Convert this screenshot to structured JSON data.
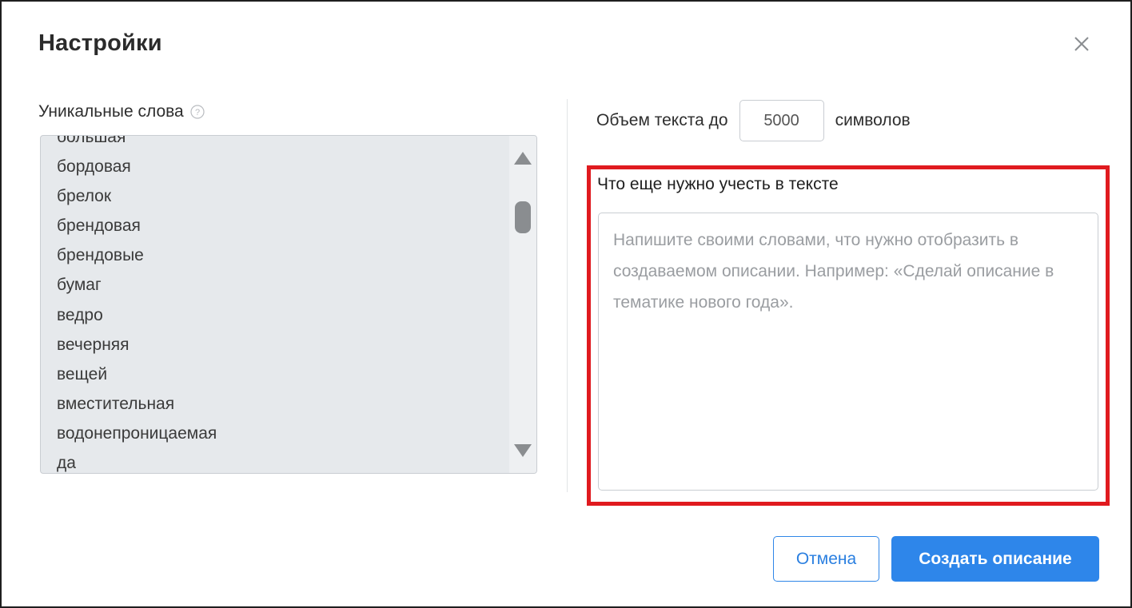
{
  "dialog": {
    "title": "Настройки",
    "close_icon": "close-icon"
  },
  "unique_words": {
    "label": "Уникальные слова",
    "help_icon": "question-circle-icon",
    "items": [
      "большая",
      "бордовая",
      "брелок",
      "брендовая",
      "брендовые",
      "бумаг",
      "ведро",
      "вечерняя",
      "вещей",
      "вместительная",
      "водонепроницаемая",
      "да"
    ]
  },
  "text_volume": {
    "prefix": "Объем текста до",
    "value": "5000",
    "suffix": "символов"
  },
  "extra_requirements": {
    "label": "Что еще нужно учесть в тексте",
    "placeholder": "Напишите своими словами, что нужно отобразить в создаваемом описании. Например: «Сделай описание в тематике нового года».",
    "value": ""
  },
  "buttons": {
    "cancel": "Отмена",
    "create": "Создать описание"
  },
  "colors": {
    "accent": "#2e86ea",
    "highlight": "#e01a1f",
    "list_background": "#e6e9ec"
  }
}
